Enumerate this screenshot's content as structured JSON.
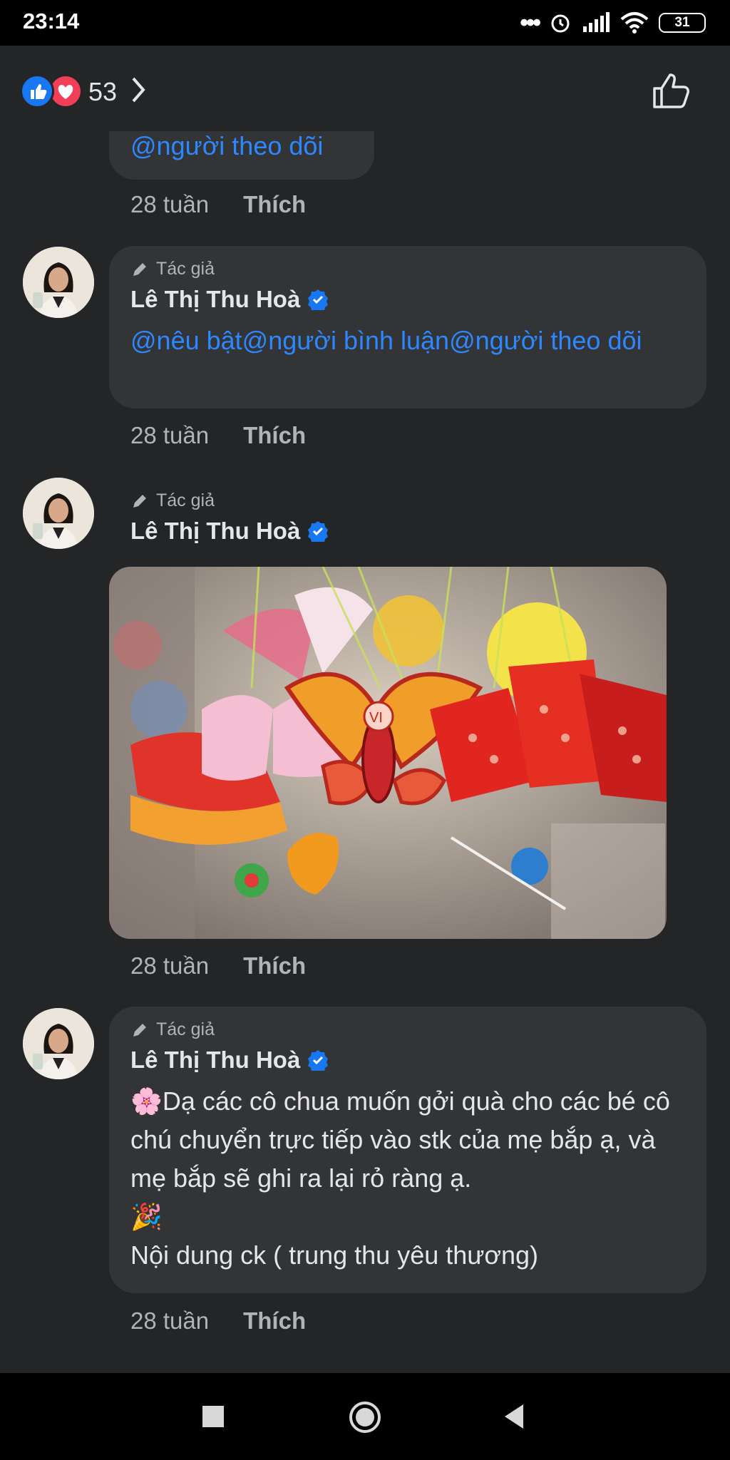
{
  "status_bar": {
    "time": "23:14",
    "dots": "•••",
    "battery": "31"
  },
  "reactions": {
    "count": "53",
    "colors": {
      "like": "#1877f2",
      "love": "#f33e58"
    }
  },
  "partial_comment": {
    "text": "@người theo dõi",
    "time": "28 tuần",
    "like_label": "Thích"
  },
  "comments": [
    {
      "badge": "Tác giả",
      "name": "Lê Thị Thu Hoà",
      "text": "@nêu bật@người bình luận@người theo dõi",
      "time": "28 tuần",
      "like_label": "Thích"
    },
    {
      "badge": "Tác giả",
      "name": "Lê Thị Thu Hoà",
      "time": "28 tuần",
      "like_label": "Thích"
    },
    {
      "badge": "Tác giả",
      "name": "Lê Thị Thu Hoà",
      "line1": "🌸Dạ các cô chua muốn gởi quà cho các bé cô chú chuyển trực tiếp vào stk của mẹ bắp ạ, và mẹ bắp sẽ ghi ra lại rỏ ràng ạ.",
      "line2": "🎉",
      "line3": "Nội dung ck ( trung thu yêu thương)",
      "time": "28 tuần",
      "like_label": "Thích"
    }
  ],
  "photo": {
    "lantern_text": "VI"
  },
  "colors": {
    "background": "#242527",
    "bubble": "#333436",
    "mention": "#2d88ff",
    "verified": "#1877f2"
  },
  "icons": [
    "like-reaction-icon",
    "love-reaction-icon",
    "chevron-right-icon",
    "thumbs-up-icon",
    "pencil-icon",
    "verified-badge-icon",
    "recent-apps-icon",
    "home-icon",
    "back-icon"
  ]
}
